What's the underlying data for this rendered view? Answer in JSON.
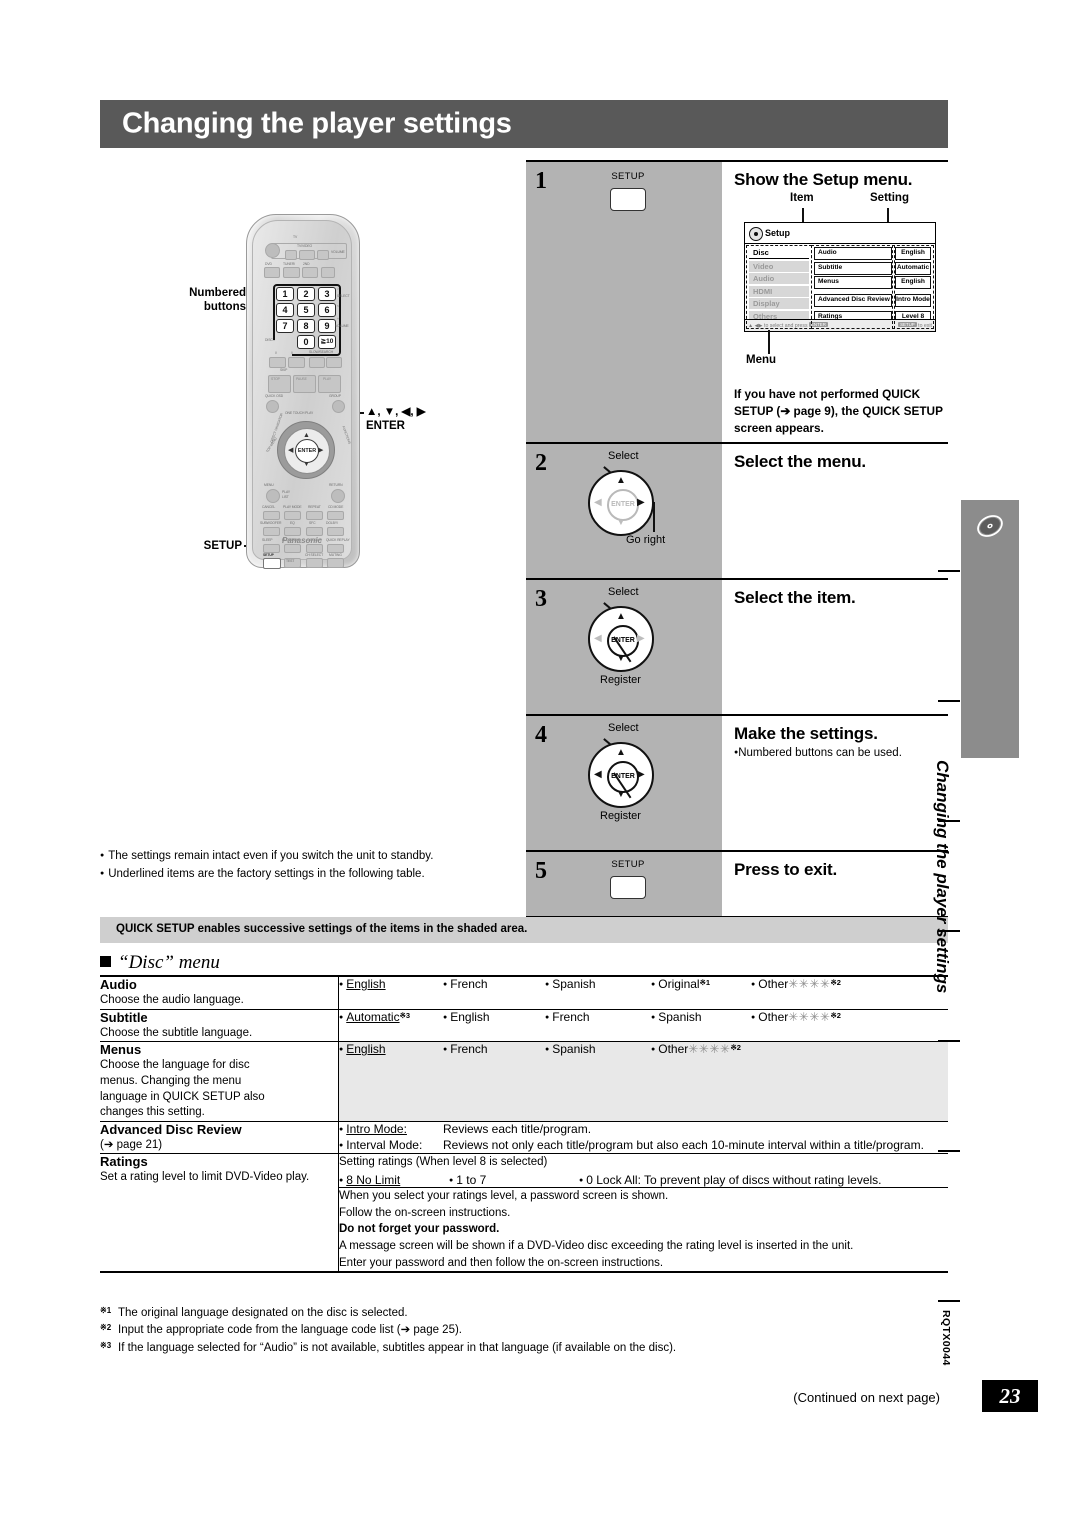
{
  "header": {
    "title": "Changing the player settings"
  },
  "remote": {
    "brand": "Panasonic",
    "callout_numbered": "Numbered\nbuttons",
    "callout_numbered_l1": "Numbered",
    "callout_numbered_l2": "buttons",
    "callout_arrows_l1": "▲, ▼, ◀, ▶",
    "callout_arrows_l2": "ENTER",
    "callout_setup": "SETUP",
    "keys": [
      "1",
      "2",
      "3",
      "4",
      "5",
      "6",
      "7",
      "8",
      "9",
      "0",
      "≧10"
    ],
    "section_tv": "TV",
    "labels": [
      "TV/VIDEO",
      "VOLUME",
      "DVD",
      "TUNER/ BAND",
      "2ND SELECT",
      "DISC",
      "SLOW/SEARCH",
      "SKIP",
      "STOP",
      "PAUSE",
      "PLAY",
      "QUICK OSD",
      "GROUP",
      "ONE TOUCH PLAY",
      "DIRECT NAVIGATOR",
      "TOP MENU",
      "FUNCTIONS",
      "MENU",
      "RETURN",
      "PLAY LIST",
      "CANCEL",
      "PLAY MODE",
      "REPEAT",
      "CD MODE",
      "SUBWOOFER LEVEL",
      "EQ",
      "SFC MUSIC",
      "DOLBY/ S.SRD",
      "SLEEP",
      "FL DISPLAY",
      "C.FOCUS",
      "QUICK REPLAY",
      "SETUP",
      "TEST",
      "CH SELECT",
      "MUTING"
    ],
    "enter_label": "ENTER"
  },
  "steps": [
    {
      "num": "1",
      "heading": "Show the Setup menu.",
      "key_label": "SETUP",
      "note": "If you have not performed QUICK SETUP (➔ page 9), the QUICK SETUP screen appears.",
      "annotations": {
        "item": "Item",
        "setting": "Setting",
        "menu": "Menu"
      }
    },
    {
      "num": "2",
      "heading": "Select the menu.",
      "jog_top": "Select",
      "jog_bottom": "Go right",
      "enter_label": "ENTER"
    },
    {
      "num": "3",
      "heading": "Select the item.",
      "jog_top": "Select",
      "jog_bottom": "Register",
      "enter_label": "ENTER"
    },
    {
      "num": "4",
      "heading": "Make the settings.",
      "jog_top": "Select",
      "jog_bottom": "Register",
      "enter_label": "ENTER",
      "sub": "Numbered buttons can be used."
    },
    {
      "num": "5",
      "heading": "Press to exit.",
      "key_label": "SETUP"
    }
  ],
  "osd": {
    "title": "Setup",
    "menus": [
      "Disc",
      "Video",
      "Audio",
      "HDMI",
      "Display",
      "Others"
    ],
    "rows": [
      {
        "item": "Audio",
        "setting": "English"
      },
      {
        "item": "Subtitle",
        "setting": "Automatic"
      },
      {
        "item": "Menus",
        "setting": "English"
      },
      {
        "item": "Advanced Disc Review",
        "setting": "Intro Mode"
      },
      {
        "item": "Ratings",
        "setting": "Level 8"
      }
    ],
    "footer_left_text": "to select and press",
    "footer_left_key": "ENTER",
    "footer_right_text": "to exit",
    "footer_right_key": "SETUP"
  },
  "notes": [
    "The settings remain intact even if you switch the unit to standby.",
    "Underlined items are the factory settings in the following table."
  ],
  "quick_setup_banner": "QUICK SETUP enables successive settings of the items in the shaded area.",
  "section_heading": "“Disc” menu",
  "table": {
    "rows": [
      {
        "name": "Audio",
        "desc": "Choose the audio language.",
        "shaded": false,
        "options": [
          {
            "label": "English",
            "underline": true
          },
          {
            "label": "French"
          },
          {
            "label": "Spanish"
          },
          {
            "label": "Original",
            "fn": "※1"
          },
          {
            "label": "Other",
            "stars": "✳✳✳✳",
            "fn": "※2"
          }
        ]
      },
      {
        "name": "Subtitle",
        "desc": "Choose the subtitle language.",
        "shaded": false,
        "options": [
          {
            "label": "Automatic",
            "underline": true,
            "fn": "※3"
          },
          {
            "label": "English"
          },
          {
            "label": "French"
          },
          {
            "label": "Spanish"
          },
          {
            "label": "Other",
            "stars": "✳✳✳✳",
            "fn": "※2"
          }
        ]
      },
      {
        "name": "Menus",
        "desc": "Choose the language for disc menus. Changing the menu language in QUICK SETUP also changes this setting.",
        "shaded": true,
        "options": [
          {
            "label": "English",
            "underline": true
          },
          {
            "label": "French"
          },
          {
            "label": "Spanish"
          },
          {
            "label": "Other",
            "stars": "✳✳✳✳",
            "fn": "※2"
          }
        ]
      }
    ],
    "adr": {
      "name": "Advanced Disc Review",
      "desc": "(➔ page 21)",
      "defs": [
        {
          "key": "Intro Mode:",
          "underline": true,
          "value": "Reviews each title/program."
        },
        {
          "key": "Interval Mode:",
          "underline": false,
          "value": "Reviews not only each title/program but also each 10-minute interval within a title/program."
        }
      ]
    },
    "ratings": {
      "name": "Ratings",
      "desc": "Set a rating level to limit DVD-Video play.",
      "intro": "Setting ratings (When level 8 is selected)",
      "options": [
        {
          "label": "8 No Limit",
          "underline": true
        },
        {
          "label": "1 to 7"
        },
        {
          "label": "0 Lock All: To prevent play of discs without rating levels."
        }
      ],
      "body": [
        "When you select your ratings level, a password screen is shown.",
        "Follow the on-screen instructions.",
        "Do not forget your password.",
        "A message screen will be shown if a DVD-Video disc exceeding the rating level is inserted in the unit.",
        "Enter your password and then follow the on-screen instructions."
      ],
      "bold_line_index": 2
    }
  },
  "footnotes": [
    {
      "mark": "※1",
      "text": "The original language designated on the disc is selected."
    },
    {
      "mark": "※2",
      "text": "Input the appropriate code from the language code list (➔ page 25)."
    },
    {
      "mark": "※3",
      "text": "If the language selected for “Audio” is not available, subtitles appear in that language (if available on the disc)."
    }
  ],
  "continued": "(Continued on next page)",
  "rail": {
    "vertical_title": "Changing the player settings",
    "doc_code": "RQTX0044",
    "page_number": "23"
  }
}
